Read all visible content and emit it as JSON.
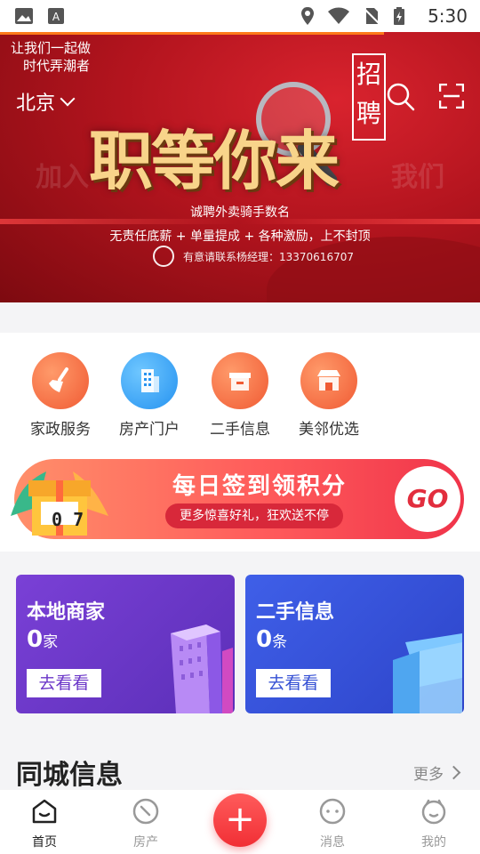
{
  "status_bar": {
    "time": "5:30"
  },
  "hero": {
    "slogan_line1": "让我们一起做",
    "slogan_line2": "时代弄潮者",
    "city": "北京",
    "headline": "职等你来",
    "bg_left": "加入",
    "bg_right": "我们",
    "recruit": "招聘",
    "line1": "诚聘外卖骑手数名",
    "line2": "无责任底薪 + 单量提成 + 各种激励，上不封顶",
    "line3": "有意请联系杨经理：13370616707"
  },
  "services": [
    {
      "label": "家政服务",
      "icon": "broom-icon"
    },
    {
      "label": "房产门户",
      "icon": "building-icon"
    },
    {
      "label": "二手信息",
      "icon": "box-icon"
    },
    {
      "label": "美邻优选",
      "icon": "shop-icon"
    }
  ],
  "checkin": {
    "title": "每日签到领积分",
    "subtitle": "更多惊喜好礼，狂欢送不停",
    "go": "GO",
    "gift_number": "0 7"
  },
  "cards": [
    {
      "title": "本地商家",
      "count": "0",
      "unit": "家",
      "button": "去看看"
    },
    {
      "title": "二手信息",
      "count": "0",
      "unit": "条",
      "button": "去看看"
    }
  ],
  "section": {
    "title": "同城信息",
    "more": "更多"
  },
  "tabs": [
    {
      "label": "首页",
      "active": true
    },
    {
      "label": "房产",
      "active": false
    },
    {
      "label": "消息",
      "active": false
    },
    {
      "label": "我的",
      "active": false
    }
  ],
  "colors": {
    "accent": "#f12f35",
    "hero_red": "#b3141e",
    "purple_card": "#6b36c8",
    "blue_card": "#3651d4"
  }
}
